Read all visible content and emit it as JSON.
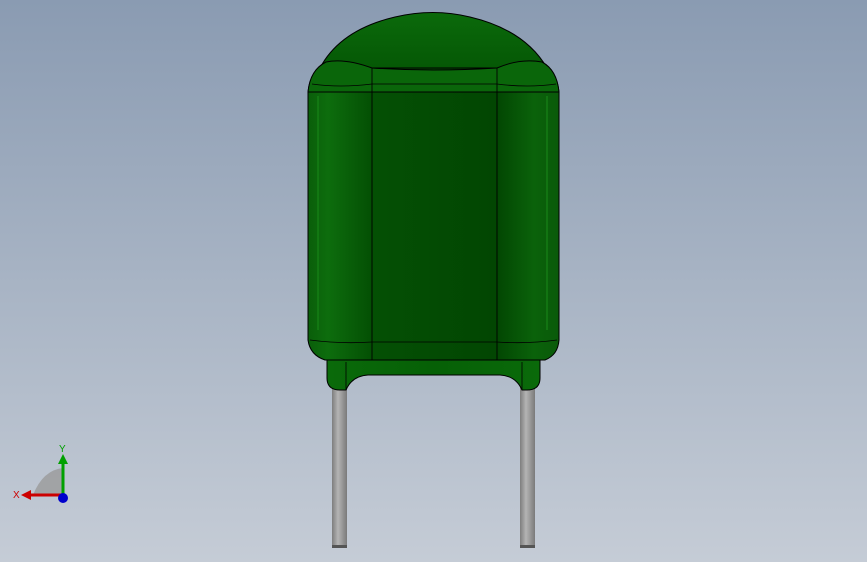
{
  "viewport": {
    "background_top": "#8a9bb2",
    "background_bottom": "#c4ccd6"
  },
  "model": {
    "body_color": "#045204",
    "body_light": "#0c6e0c",
    "body_dark": "#023c02",
    "lead_color": "#9a9a9a"
  },
  "triad": {
    "x_label": "X",
    "y_label": "Y",
    "x_color": "#cc0000",
    "y_color": "#00a000",
    "z_color": "#0000cc"
  }
}
